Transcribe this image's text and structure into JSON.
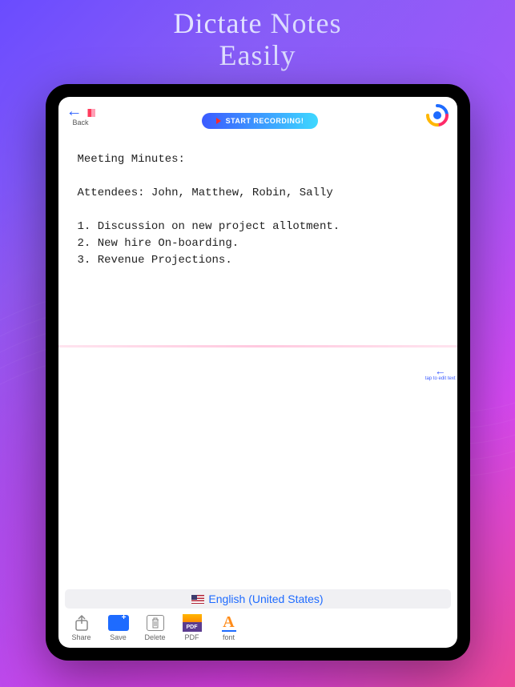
{
  "marketing": {
    "line1": "Dictate Notes",
    "line2": "Easily"
  },
  "header": {
    "back_label": "Back",
    "record_label": "START RECORDING!"
  },
  "note_content": "Meeting Minutes:\n\nAttendees: John, Matthew, Robin, Sally\n\n1. Discussion on new project allotment.\n2. New hire On-boarding.\n3. Revenue Projections.",
  "edit_hint": "tap to edit text",
  "language": {
    "label": "English (United States)",
    "flag": "us"
  },
  "toolbar": {
    "share": "Share",
    "save": "Save",
    "delete": "Delete",
    "pdf": "PDF",
    "font": "font"
  }
}
